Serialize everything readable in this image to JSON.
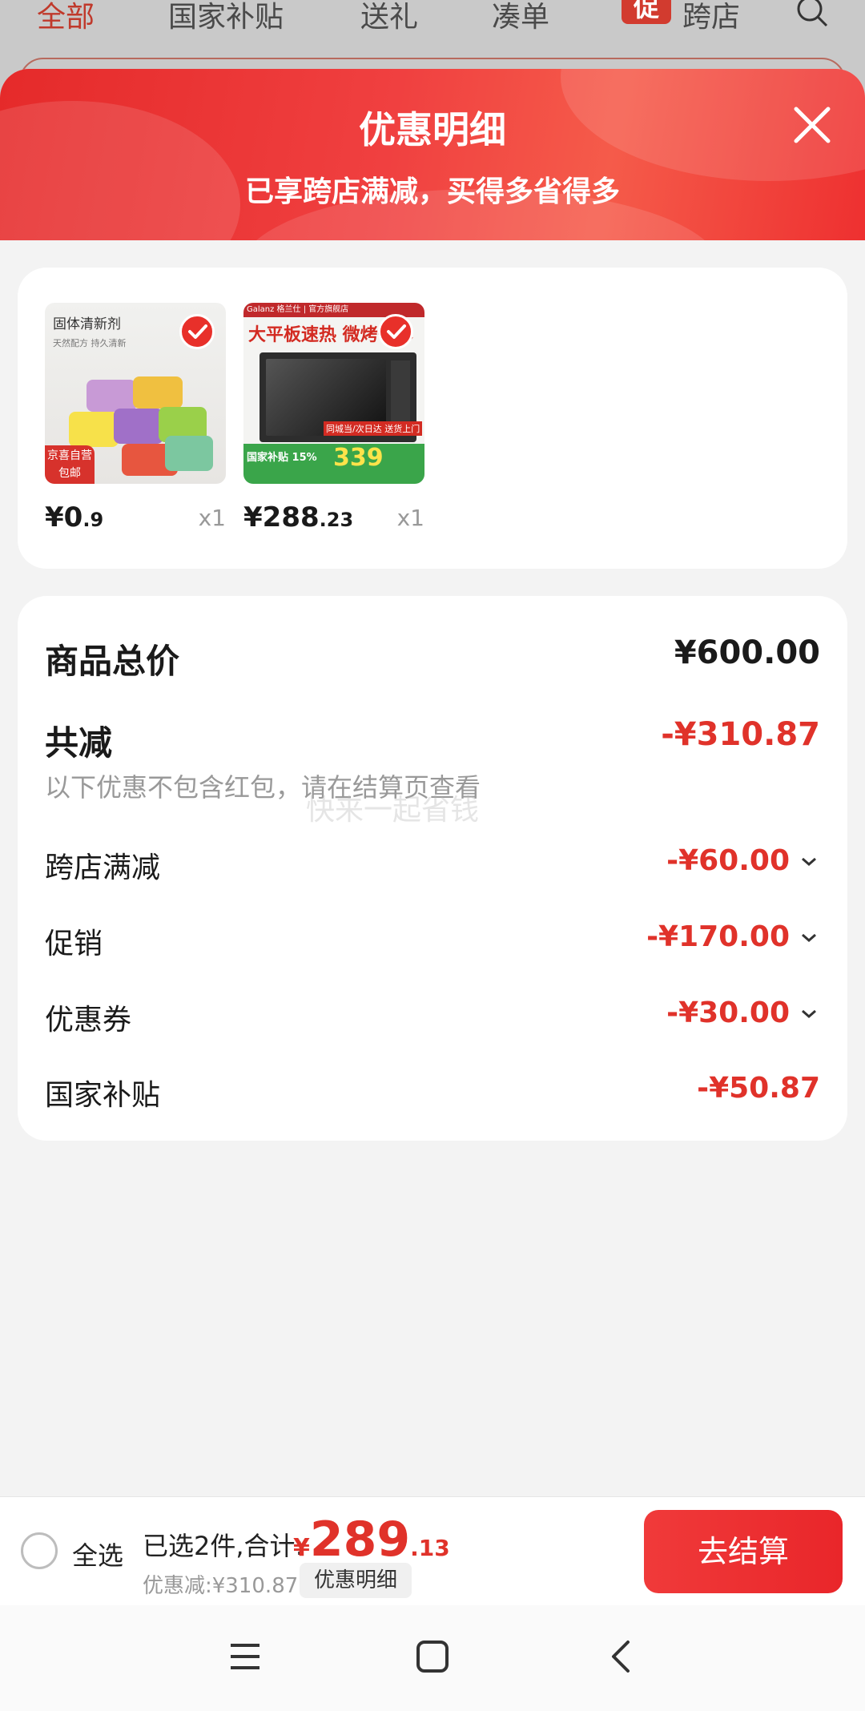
{
  "background_tabs": [
    "全部",
    "国家补贴",
    "送礼",
    "凑单",
    "促",
    "跨店"
  ],
  "sheet": {
    "title": "优惠明细",
    "subtitle": "已享跨店满减，买得多省得多",
    "close_icon": "close-icon"
  },
  "products": [
    {
      "thumb_title": "固体清新剂",
      "thumb_sub": "天然配方 持久清新",
      "badge": "京喜自营 包邮",
      "price_int": "¥0",
      "price_dec": ".9",
      "qty": "x1",
      "checked": true
    },
    {
      "thumb_brand": "Galanz 格兰仕 | 官方旗舰店",
      "thumb_title": "大平板速热 微烤一体",
      "thumb_tag": "国家补贴 15%",
      "thumb_price": "339",
      "thumb_delivery": "同城当/次日达 送货上门",
      "price_int": "¥288",
      "price_dec": ".23",
      "qty": "x1",
      "checked": true
    }
  ],
  "summary": {
    "total_label": "商品总价",
    "total_value": "¥600.00",
    "reduce_label": "共减",
    "reduce_value": "-¥310.87",
    "hint": "以下优惠不包含红包，请在结算页查看",
    "watermark": "快来一起省钱",
    "items": [
      {
        "label": "跨店满减",
        "value": "-¥60.00",
        "expandable": true
      },
      {
        "label": "促销",
        "value": "-¥170.00",
        "expandable": true
      },
      {
        "label": "优惠券",
        "value": "-¥30.00",
        "expandable": true
      },
      {
        "label": "国家补贴",
        "value": "-¥50.87",
        "expandable": false
      }
    ]
  },
  "bottom_bar": {
    "select_all": "全选",
    "selected_text": "已选2件,合计:",
    "currency": "¥",
    "total_int": "289",
    "total_dec": ".13",
    "discount_text": "优惠减:¥310.87",
    "detail_button": "优惠明细",
    "checkout_button": "去结算"
  },
  "colors": {
    "accent": "#e0322a",
    "hero": "#ee3030"
  }
}
